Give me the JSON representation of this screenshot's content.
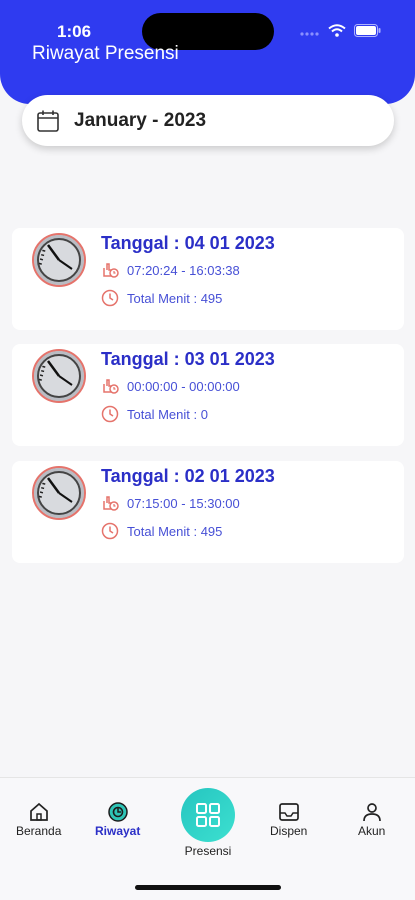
{
  "status_bar": {
    "time": "1:06"
  },
  "header": {
    "title": "Riwayat Presensi"
  },
  "month_picker": {
    "label": "January - 2023",
    "icon": "calendar-icon"
  },
  "records": [
    {
      "tanggal": "Tanggal : 04 01 2023",
      "time_range": "07:20:24 - 16:03:38",
      "total": "Total Menit : 495"
    },
    {
      "tanggal": "Tanggal : 03 01 2023",
      "time_range": "00:00:00 - 00:00:00",
      "total": "Total Menit : 0"
    },
    {
      "tanggal": "Tanggal : 02 01 2023",
      "time_range": "07:15:00 - 15:30:00",
      "total": "Total Menit : 495"
    }
  ],
  "bottom_nav": {
    "beranda": "Beranda",
    "riwayat": "Riwayat",
    "presensi": "Presensi",
    "dispen": "Dispen",
    "akun": "Akun"
  },
  "colors": {
    "primary": "#2f3bf0",
    "accent_text": "#2b2fc7",
    "teal": "#25c5c0",
    "icon_red": "#e5736b"
  }
}
